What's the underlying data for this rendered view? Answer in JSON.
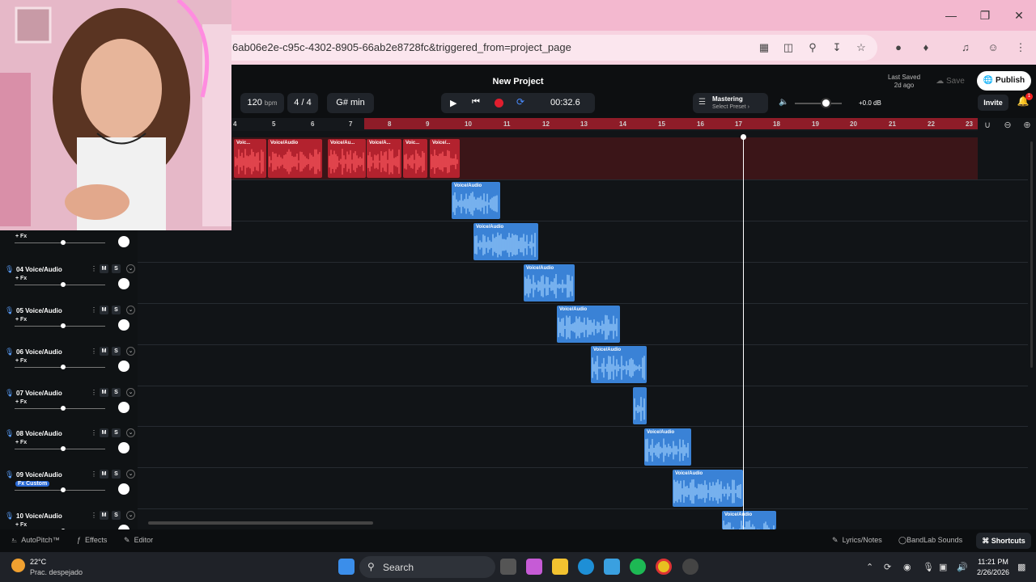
{
  "browser": {
    "url": "6ab06e2e-c95c-4302-8905-66ab2e8728fc&triggered_from=project_page"
  },
  "project": {
    "title": "New Project",
    "bpm": "120",
    "bpm_unit": "bpm",
    "time_sig": "4 / 4",
    "key": "G# min",
    "time": "00:32.6",
    "last_saved_label": "Last Saved",
    "last_saved_value": "2d ago",
    "save_label": "Save",
    "publish_label": "Publish",
    "invite_label": "Invite",
    "notif_count": "1"
  },
  "mastering": {
    "label": "Mastering",
    "preset": "Select Preset ›"
  },
  "volume": {
    "db": "+0.0 dB"
  },
  "ruler": {
    "numbers": [
      "4",
      "5",
      "6",
      "7",
      "8",
      "9",
      "10",
      "11",
      "12",
      "13",
      "14",
      "15",
      "16",
      "17",
      "18",
      "19",
      "20",
      "21",
      "22",
      "23"
    ]
  },
  "colors": {
    "accent_red": "#c81f2d",
    "clip_blue": "#3a82d6",
    "clip_red": "#b3222e"
  },
  "tracks": [
    {
      "num": "",
      "name": "",
      "fx": "+ Fx"
    },
    {
      "num": "04",
      "name": "Voice/Audio",
      "fx": "+ Fx"
    },
    {
      "num": "05",
      "name": "Voice/Audio",
      "fx": "+ Fx"
    },
    {
      "num": "06",
      "name": "Voice/Audio",
      "fx": "+ Fx"
    },
    {
      "num": "07",
      "name": "Voice/Audio",
      "fx": "+ Fx"
    },
    {
      "num": "08",
      "name": "Voice/Audio",
      "fx": "+ Fx"
    },
    {
      "num": "09",
      "name": "Voice/Audio",
      "fx": "Fx Custom"
    },
    {
      "num": "10",
      "name": "Voice/Audio",
      "fx": "+ Fx"
    }
  ],
  "track_buttons": {
    "mute": "M",
    "solo": "S"
  },
  "red_clips": [
    "Voic...",
    "Voice/Audio",
    "Voice/Au...",
    "Voice/A...",
    "Voic...",
    "Voice/..."
  ],
  "blue_clip_label": "Voice/Audio",
  "bottom": {
    "autopitch": "AutoPitch™",
    "effects": "Effects",
    "editor": "Editor",
    "lyrics": "Lyrics/Notes",
    "sounds": "BandLab Sounds",
    "shortcuts": "Shortcuts"
  },
  "taskbar": {
    "temp": "22°C",
    "weather": "Prac. despejado",
    "search": "Search",
    "time": "11:21 PM",
    "date": "2/26/2026"
  }
}
